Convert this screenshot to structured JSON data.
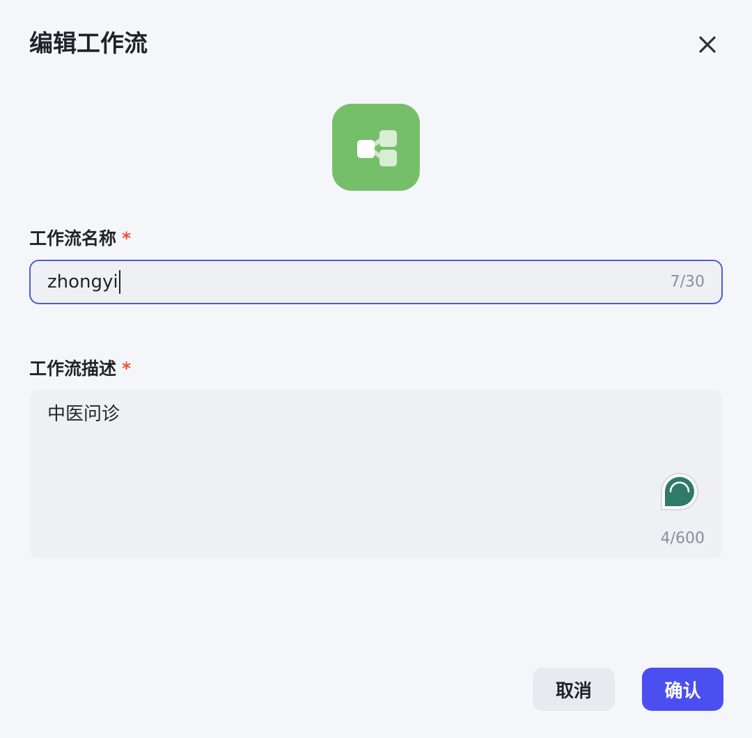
{
  "dialog": {
    "title": "编辑工作流"
  },
  "icons": {
    "close": "close-icon",
    "workflow": "workflow-icon",
    "assistant": "assistant-bubble-icon"
  },
  "colors": {
    "workflow_icon_bg": "#76bf6a",
    "primary": "#4b4ff0",
    "required": "#e5533a",
    "focus_border": "#4f5bd5"
  },
  "form": {
    "name": {
      "label": "工作流名称",
      "required_mark": "*",
      "value": "zhongyi",
      "count": "7/30"
    },
    "description": {
      "label": "工作流描述",
      "required_mark": "*",
      "value": "中医问诊",
      "count": "4/600"
    }
  },
  "footer": {
    "cancel_label": "取消",
    "confirm_label": "确认"
  }
}
